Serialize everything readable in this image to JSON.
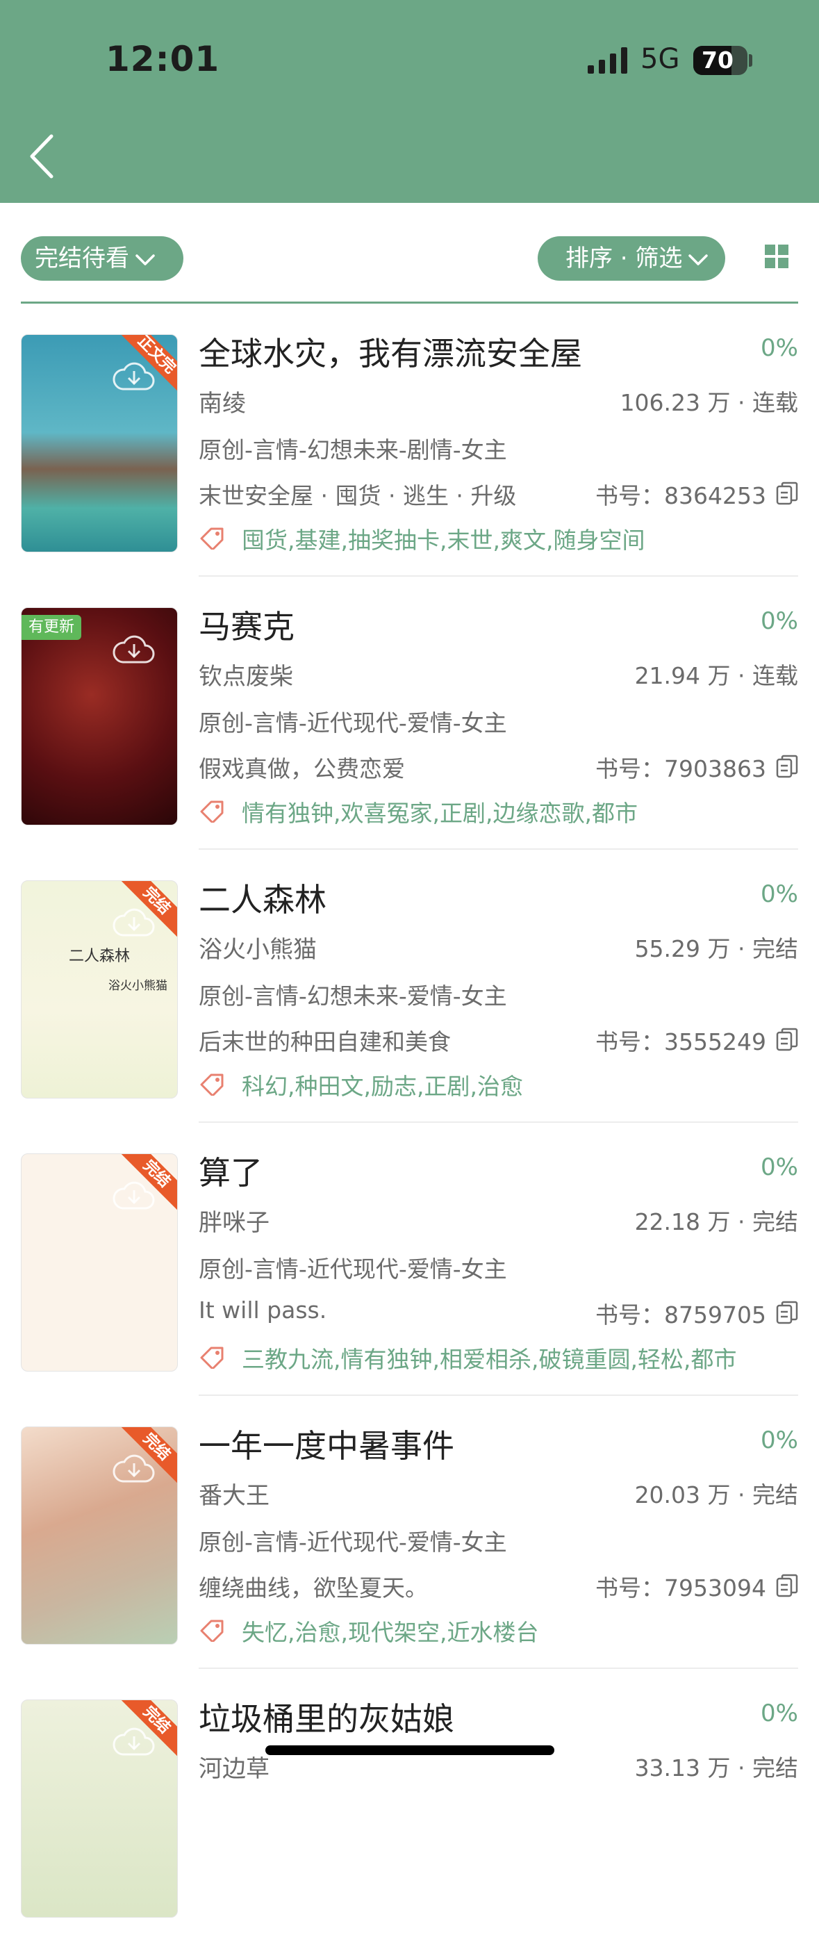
{
  "status_bar": {
    "time": "12:01",
    "network": "5G",
    "battery": "70",
    "battery_level": 0.7
  },
  "toolbar": {
    "filter_label": "完结待看",
    "sort_label": "排序 · 筛选"
  },
  "colors": {
    "accent": "#6ca786",
    "ribbon": "#e85a2a",
    "update_badge": "#5fb85a"
  },
  "books": [
    {
      "title": "全球水灾，我有漂流安全屋",
      "progress": "0%",
      "author": "南绫",
      "words": "106.23 万 · 连载",
      "category": "原创-言情-幻想未来-剧情-女主",
      "intro": "末世安全屋 · 囤货 · 逃生 · 升级",
      "book_no": "书号：8364253",
      "tags": "囤货,基建,抽奖抽卡,末世,爽文,随身空间",
      "ribbon": "正文完",
      "cover": {
        "bg": "linear-gradient(180deg,#3c9bb5 0%,#5fb7c6 45%,#7a6250 62%,#4fb1a7 80%,#2f8f95 100%)"
      }
    },
    {
      "title": "马赛克",
      "progress": "0%",
      "author": "钦点废柴",
      "words": "21.94 万 · 连载",
      "category": "原创-言情-近代现代-爱情-女主",
      "intro": "假戏真做，公费恋爱",
      "book_no": "书号：7903863",
      "tags": "情有独钟,欢喜冤家,正剧,边缘恋歌,都市",
      "badge": "有更新",
      "cover": {
        "bg": "radial-gradient(circle at 45% 40%,#9a2c24 0%,#5a0f12 55%,#2a0608 100%)"
      }
    },
    {
      "title": "二人森林",
      "progress": "0%",
      "author": "浴火小熊猫",
      "words": "55.29 万 · 完结",
      "category": "原创-言情-幻想未来-爱情-女主",
      "intro": "后末世的种田自建和美食",
      "book_no": "书号：3555249",
      "tags": "科幻,种田文,励志,正剧,治愈",
      "ribbon": "完结",
      "cover": {
        "bg": "linear-gradient(180deg,#f1f4dc 0%,#f7f5e2 60%,#eef2d6 100%)",
        "title": "二人森林",
        "author": "浴火小熊猫"
      }
    },
    {
      "title": "算了",
      "progress": "0%",
      "author": "胖咪子",
      "words": "22.18 万 · 完结",
      "category": "原创-言情-近代现代-爱情-女主",
      "intro": "It will pass.",
      "book_no": "书号：8759705",
      "tags": "三教九流,情有独钟,相爱相杀,破镜重圆,轻松,都市",
      "ribbon": "完结",
      "cover": {
        "bg": "#fbf3ea"
      }
    },
    {
      "title": "一年一度中暑事件",
      "progress": "0%",
      "author": "番大王",
      "words": "20.03 万 · 完结",
      "category": "原创-言情-近代现代-爱情-女主",
      "intro": "缠绕曲线，欲坠夏天。",
      "book_no": "书号：7953094",
      "tags": "失忆,治愈,现代架空,近水楼台",
      "ribbon": "完结",
      "cover": {
        "bg": "linear-gradient(160deg,#f3dccb 0%,#d9a98f 40%,#c9b6a0 70%,#b9cfb4 100%)"
      }
    },
    {
      "title": "垃圾桶里的灰姑娘",
      "progress": "0%",
      "author": "河边草",
      "words": "33.13 万 · 完结",
      "category": "",
      "intro": "",
      "book_no": "",
      "tags": "",
      "ribbon": "完结",
      "cover": {
        "bg": "linear-gradient(180deg,#eef1dd 0%,#dbe6c6 100%)"
      }
    }
  ]
}
